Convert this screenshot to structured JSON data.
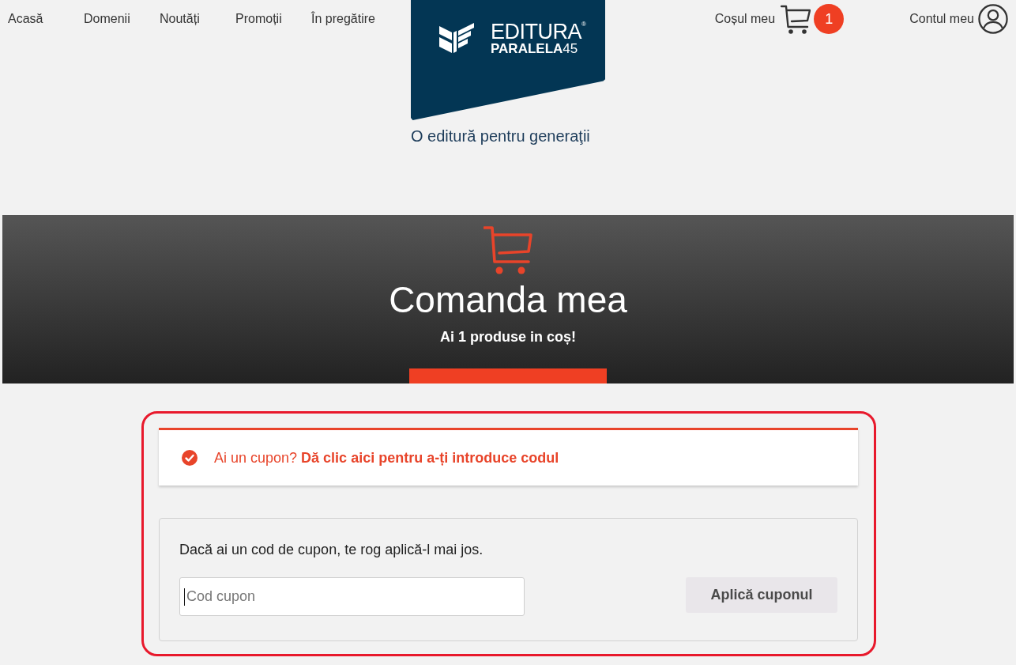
{
  "nav": {
    "links": [
      {
        "label": "Acasă"
      },
      {
        "label": "Domenii"
      },
      {
        "label": "Noutăți"
      },
      {
        "label": "Promoții"
      },
      {
        "label": "În pregătire"
      }
    ]
  },
  "logo": {
    "word": "EDITURA",
    "registered": "®",
    "name": "PARALELA",
    "number": "45",
    "tagline": "O editură pentru generaţii"
  },
  "cart": {
    "label": "Coșul meu",
    "count": "1"
  },
  "account": {
    "label": "Contul meu"
  },
  "hero": {
    "title": "Comanda mea",
    "subtitle": "Ai 1 produse in coș!"
  },
  "coupon": {
    "highlighted": true,
    "notice": {
      "text": "Ai un cupon?",
      "link": "Dă clic aici pentru a-ți introduce codul"
    },
    "form": {
      "instruction": "Dacă ai un cod de cupon, te rog aplică-l mai jos.",
      "input": {
        "placeholder": "Cod cupon",
        "focused": true
      },
      "button": "Aplică cuponul"
    }
  }
}
